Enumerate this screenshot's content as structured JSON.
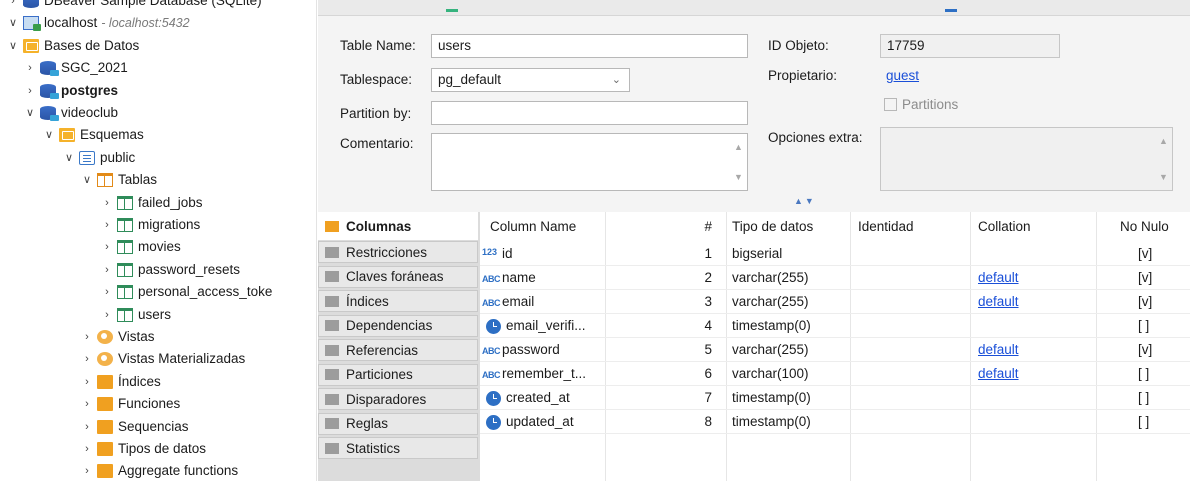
{
  "tree": [
    {
      "label": "DBeaver Sample Database (SQLite)",
      "icon": "database-icon",
      "depth": 0,
      "expanded": false,
      "partial": true
    },
    {
      "label": "localhost",
      "sub": "- localhost:5432",
      "icon": "server-icon",
      "depth": 0,
      "expanded": true
    },
    {
      "label": "Bases de Datos",
      "icon": "folder-icon",
      "depth": 1,
      "expanded": true
    },
    {
      "label": "SGC_2021",
      "icon": "database-icon",
      "depth": 2,
      "expanded": false
    },
    {
      "label": "postgres",
      "icon": "database-icon",
      "depth": 2,
      "expanded": false,
      "bold": true
    },
    {
      "label": "videoclub",
      "icon": "database-icon",
      "depth": 2,
      "expanded": true
    },
    {
      "label": "Esquemas",
      "icon": "folder-icon",
      "depth": 3,
      "expanded": true
    },
    {
      "label": "public",
      "icon": "schema-icon",
      "depth": 4,
      "expanded": true
    },
    {
      "label": "Tablas",
      "icon": "folder-icon",
      "depth": 5,
      "expanded": true
    },
    {
      "label": "failed_jobs",
      "icon": "table-icon",
      "depth": 6,
      "expanded": false
    },
    {
      "label": "migrations",
      "icon": "table-icon",
      "depth": 6,
      "expanded": false
    },
    {
      "label": "movies",
      "icon": "table-icon",
      "depth": 6,
      "expanded": false
    },
    {
      "label": "password_resets",
      "icon": "table-icon",
      "depth": 6,
      "expanded": false
    },
    {
      "label": "personal_access_toke",
      "icon": "table-icon",
      "depth": 6,
      "expanded": false
    },
    {
      "label": "users",
      "icon": "table-icon",
      "depth": 6,
      "expanded": false
    },
    {
      "label": "Vistas",
      "icon": "view-icon",
      "depth": 5,
      "expanded": false
    },
    {
      "label": "Vistas Materializadas",
      "icon": "view-icon",
      "depth": 5,
      "expanded": false
    },
    {
      "label": "Índices",
      "icon": "folder-icon",
      "depth": 5,
      "expanded": false
    },
    {
      "label": "Funciones",
      "icon": "folder-icon",
      "depth": 5,
      "expanded": false
    },
    {
      "label": "Sequencias",
      "icon": "folder-icon",
      "depth": 5,
      "expanded": false
    },
    {
      "label": "Tipos de datos",
      "icon": "folder-icon",
      "depth": 5,
      "expanded": false
    },
    {
      "label": "Aggregate functions",
      "icon": "folder-icon",
      "depth": 5,
      "expanded": false,
      "partial": true
    }
  ],
  "props": {
    "table_name_label": "Table Name:",
    "table_name_value": "users",
    "tablespace_label": "Tablespace:",
    "tablespace_value": "pg_default",
    "partition_label": "Partition by:",
    "partition_value": "",
    "comment_label": "Comentario:",
    "comment_value": "",
    "object_id_label": "ID Objeto:",
    "object_id_value": "17759",
    "owner_label": "Propietario:",
    "owner_value": "guest",
    "partitions_label": "Partitions",
    "extra_label": "Opciones extra:",
    "extra_value": ""
  },
  "tabs": [
    {
      "label": "Columnas",
      "active": true
    },
    {
      "label": "Restricciones"
    },
    {
      "label": "Claves foráneas"
    },
    {
      "label": "Índices"
    },
    {
      "label": "Dependencias"
    },
    {
      "label": "Referencias"
    },
    {
      "label": "Particiones"
    },
    {
      "label": "Disparadores"
    },
    {
      "label": "Reglas"
    },
    {
      "label": "Statistics",
      "partial": true
    }
  ],
  "grid": {
    "headers": {
      "name": "Column Name",
      "num": "#",
      "type": "Tipo de datos",
      "identity": "Identidad",
      "collation": "Collation",
      "notnull": "No Nulo"
    },
    "rows": [
      {
        "icon": "numeric-icon",
        "name": "id",
        "num": "1",
        "type": "bigserial",
        "identity": "",
        "collation": "",
        "notnull": "[v]"
      },
      {
        "icon": "text-icon",
        "name": "name",
        "num": "2",
        "type": "varchar(255)",
        "identity": "",
        "collation": "default",
        "notnull": "[v]"
      },
      {
        "icon": "text-icon",
        "name": "email",
        "num": "3",
        "type": "varchar(255)",
        "identity": "",
        "collation": "default",
        "notnull": "[v]"
      },
      {
        "icon": "clock-icon",
        "name": "email_verifi...",
        "num": "4",
        "type": "timestamp(0)",
        "identity": "",
        "collation": "",
        "notnull": "[ ]"
      },
      {
        "icon": "text-icon",
        "name": "password",
        "num": "5",
        "type": "varchar(255)",
        "identity": "",
        "collation": "default",
        "notnull": "[v]"
      },
      {
        "icon": "text-icon",
        "name": "remember_t...",
        "num": "6",
        "type": "varchar(100)",
        "identity": "",
        "collation": "default",
        "notnull": "[ ]"
      },
      {
        "icon": "clock-icon",
        "name": "created_at",
        "num": "7",
        "type": "timestamp(0)",
        "identity": "",
        "collation": "",
        "notnull": "[ ]"
      },
      {
        "icon": "clock-icon",
        "name": "updated_at",
        "num": "8",
        "type": "timestamp(0)",
        "identity": "",
        "collation": "",
        "notnull": "[ ]"
      }
    ]
  },
  "colors": {
    "accent_link": "#1a4fd8",
    "folder": "#f0a020",
    "table_icon": "#2f8c5a",
    "type_icon": "#2d6fc4"
  }
}
